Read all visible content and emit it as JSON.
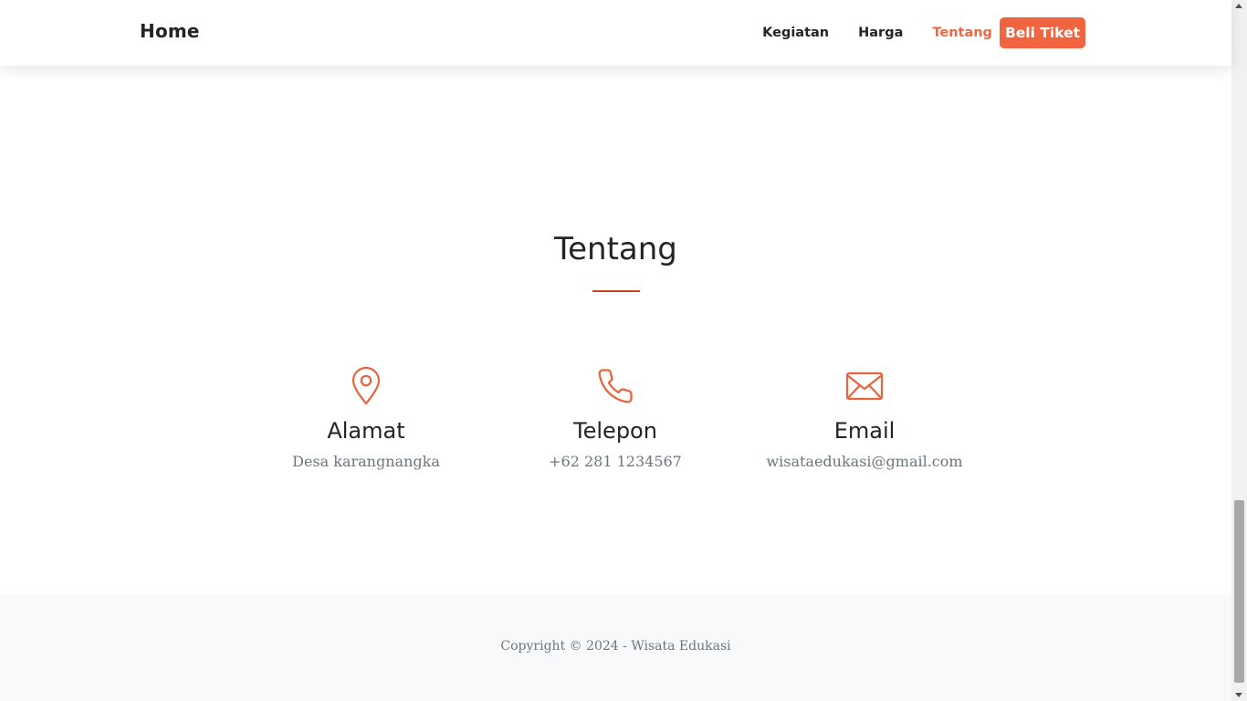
{
  "navbar": {
    "brand": "Home",
    "links": [
      {
        "label": "Kegiatan",
        "active": false
      },
      {
        "label": "Harga",
        "active": false
      },
      {
        "label": "Tentang",
        "active": true
      }
    ],
    "cta_label": "Beli Tiket"
  },
  "about": {
    "title": "Tentang",
    "items": [
      {
        "icon": "map-pin-icon",
        "label": "Alamat",
        "value": "Desa karangnangka"
      },
      {
        "icon": "phone-icon",
        "label": "Telepon",
        "value": "+62 281 1234567"
      },
      {
        "icon": "envelope-icon",
        "label": "Email",
        "value": "wisataedukasi@gmail.com"
      }
    ]
  },
  "footer": {
    "copyright": "Copyright © 2024 - Wisata Edukasi"
  },
  "colors": {
    "accent": "#f0643f",
    "text": "#212529",
    "muted": "#6c757d",
    "footer_bg": "#f8f9fa"
  }
}
